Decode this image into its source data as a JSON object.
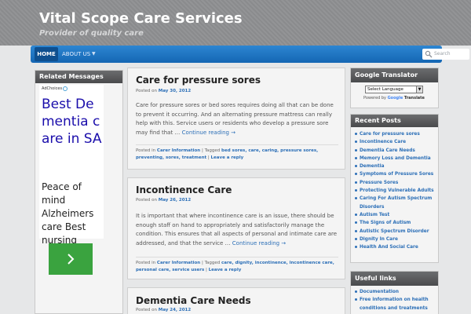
{
  "header": {
    "site_title": "Vital Scope Care Services",
    "site_description": "Provider of quality care"
  },
  "nav": {
    "items": [
      {
        "label": "HOME",
        "active": true
      },
      {
        "label": "ABOUT US",
        "has_dropdown": true
      }
    ],
    "search_placeholder": "Search"
  },
  "left_sidebar": {
    "title": "Related Messages",
    "ad": {
      "choices_label": "AdChoices",
      "headline": "Best Dementia care in SA",
      "body": "Peace of mind Alzheimers care Best nursing",
      "button_icon": "chevron-right-icon",
      "button_color": "#3aa33f"
    }
  },
  "posts": [
    {
      "title": "Care for pressure sores",
      "posted_on_label": "Posted on",
      "date": "May 30, 2012",
      "excerpt": "Care for pressure sores or bed sores requires doing all that can be done to prevent it occurring. And an alternating pressure mattress can really help with this. Service users or residents who develop a pressure sore may find that …",
      "continue": "Continue reading →",
      "meta_posted_in": "Posted in",
      "category": "Carer Information",
      "tagged_label": "Tagged",
      "tags": "bed sores, care, caring, pressure sores, preventing, sores, treatment",
      "leave_reply": "Leave a reply"
    },
    {
      "title": "Incontinence Care",
      "posted_on_label": "Posted on",
      "date": "May 26, 2012",
      "excerpt": "It is important that where incontinence care is an issue, there should be enough staff on hand to appropriately and satisfactorily manage the condition. This ensures that all aspects of personal and intimate care are addressed, and that the service …",
      "continue": "Continue reading →",
      "meta_posted_in": "Posted in",
      "category": "Carer Information",
      "tagged_label": "Tagged",
      "tags": "care, dignity, incontinence, incontinence care, personal care, service users",
      "leave_reply": "Leave a reply"
    },
    {
      "title": "Dementia Care Needs",
      "posted_on_label": "Posted on",
      "date": "May 24, 2012"
    }
  ],
  "right_sidebar": {
    "translator": {
      "title": "Google Translator",
      "select_value": "Select Language",
      "powered_by": "Powered by",
      "google_label": "Google",
      "translate_label": "Translate"
    },
    "recent_posts": {
      "title": "Recent Posts",
      "items": [
        "Care for pressure sores",
        "Incontinence Care",
        "Dementia Care Needs",
        "Memory Loss and Dementia",
        "Dementia",
        "Symptoms of Pressure Sores",
        "Pressure Sores",
        "Protecting Vulnerable Adults",
        "Caring For Autism Spectrum Disorders",
        "Autism Test",
        "The Signs of Autism",
        "Autistic Spectrum Disorder",
        "Dignity In Care",
        "Health And Social Care"
      ]
    },
    "useful_links": {
      "title": "Useful links",
      "items": [
        "Documentation",
        "Free information on health conditions and treatments"
      ]
    }
  },
  "colors": {
    "nav_blue": "#1466b3",
    "link_blue": "#2c6fb7",
    "widget_head": "#5a5b5d",
    "page_bg": "#e6e7e8"
  }
}
